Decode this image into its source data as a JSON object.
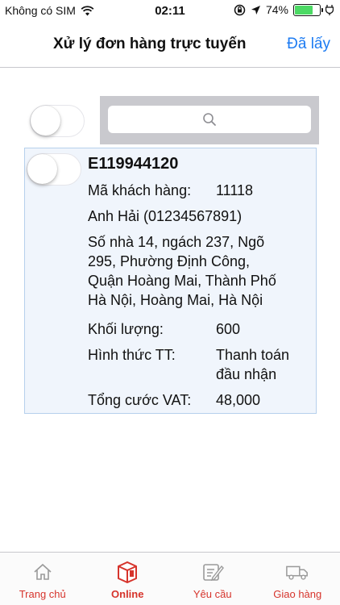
{
  "status_bar": {
    "carrier": "Không có SIM",
    "time": "02:11",
    "battery": "74%",
    "battery_level": 0.74
  },
  "nav": {
    "title": "Xử lý đơn hàng trực tuyến",
    "action": "Đã lấy"
  },
  "search": {
    "placeholder": ""
  },
  "select_all": {
    "on": false
  },
  "orders": [
    {
      "code": "E119944120",
      "selected": false,
      "customer_label": "Mã khách hàng:",
      "customer_id": "11118",
      "recipient": "Anh Hải (01234567891)",
      "address_lines": [
        "Số nhà 14, ngách 237, Ngõ",
        "295, Phường Định Công,",
        "Quận Hoàng Mai, Thành Phố",
        "Hà Nội, Hoàng Mai, Hà Nội"
      ],
      "weight_label": "Khối lượng:",
      "weight": "600",
      "payment_label": "Hình thức TT:",
      "payment_lines": [
        "Thanh toán",
        "đầu nhận"
      ],
      "total_label": "Tổng cước VAT:",
      "total": "48,000"
    }
  ],
  "tabs": [
    {
      "label": "Trang chủ",
      "icon": "home-icon",
      "active": false
    },
    {
      "label": "Online",
      "icon": "online-box-icon",
      "active": true
    },
    {
      "label": "Yêu cầu",
      "icon": "request-icon",
      "active": false
    },
    {
      "label": "Giao hàng",
      "icon": "delivery-truck-icon",
      "active": false
    }
  ],
  "colors": {
    "accent": "#1e7cf2",
    "tab_label": "#d6342c",
    "card_bg": "#f0f5fc",
    "card_border": "#b6d0ec"
  }
}
